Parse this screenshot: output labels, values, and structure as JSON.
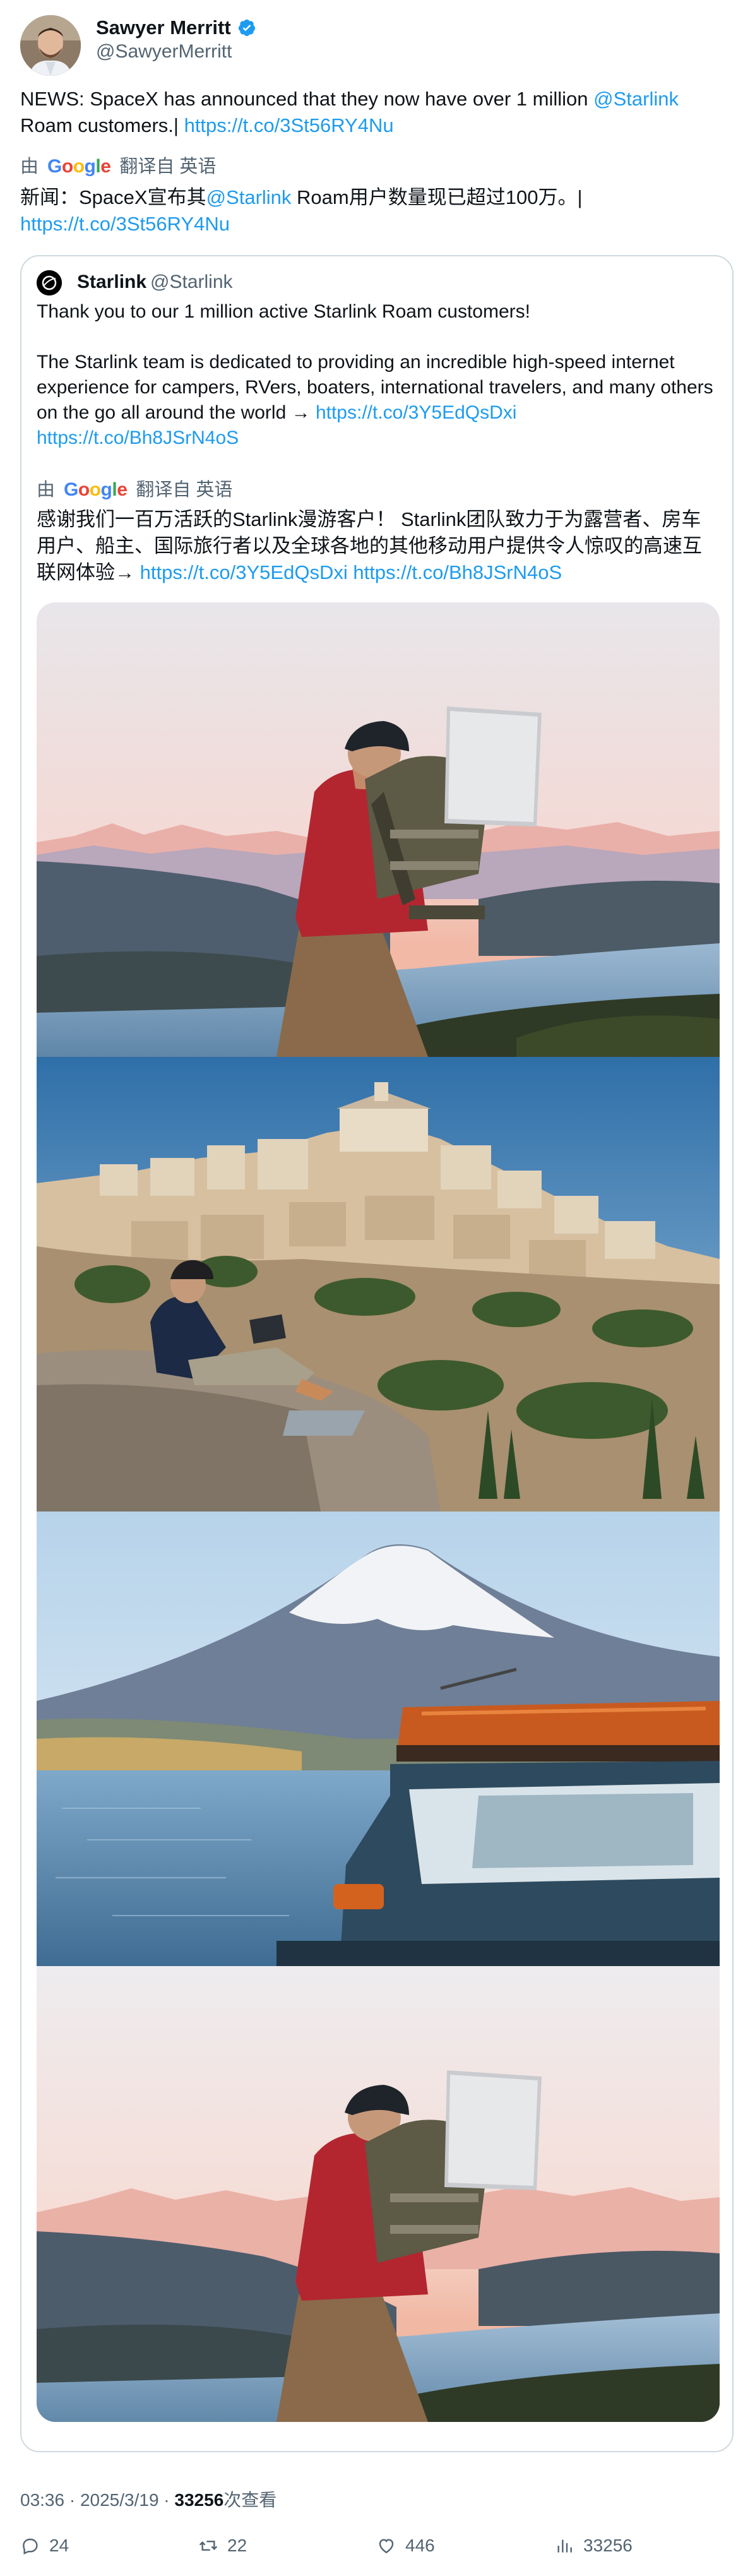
{
  "author": {
    "name": "Sawyer Merritt",
    "handle": "@SawyerMerritt"
  },
  "tweet": {
    "text_before": "NEWS: SpaceX has announced that they now have over 1 million ",
    "mention": "@Starlink",
    "text_after": " Roam customers.| ",
    "link": "https://t.co/3St56RY4Nu"
  },
  "translation": {
    "prefix": "由",
    "google": [
      "G",
      "o",
      "o",
      "g",
      "l",
      "e"
    ],
    "suffix": "翻译自 英语",
    "text_before": "新闻：SpaceX宣布其",
    "mention": "@Starlink",
    "text_after": " Roam用户数量现已超过100万。| ",
    "link": "https://t.co/3St56RY4Nu"
  },
  "quote": {
    "name": "Starlink",
    "handle": "@Starlink",
    "line1": "Thank you to our 1 million active Starlink Roam customers!",
    "line2": "The Starlink team is dedicated to providing an incredible high-speed internet experience for campers, RVers, boaters, international travelers, and many others on the go all around the world → ",
    "link1": "https://t.co/3Y5EdQsDxi",
    "link2": "https://t.co/Bh8JSrN4oS",
    "translation": {
      "prefix": "由",
      "suffix": "翻译自 英语",
      "text": "感谢我们一百万活跃的Starlink漫游客户！ Starlink团队致力于为露营者、房车用户、船主、国际旅行者以及全球各地的其他移动用户提供令人惊叹的高速互联网体验→ ",
      "link1": "https://t.co/3Y5EdQsDxi",
      "link2": "https://t.co/Bh8JSrN4oS"
    }
  },
  "meta": {
    "time": "03:36 · 2025/3/19 · ",
    "views": "33256",
    "views_label": "次查看"
  },
  "actions": {
    "replies": "24",
    "retweets": "22",
    "likes": "446",
    "views": "33256"
  },
  "colors": {
    "link": "#1d9bf0",
    "muted": "#536471",
    "verified": "#1d9bf0"
  }
}
